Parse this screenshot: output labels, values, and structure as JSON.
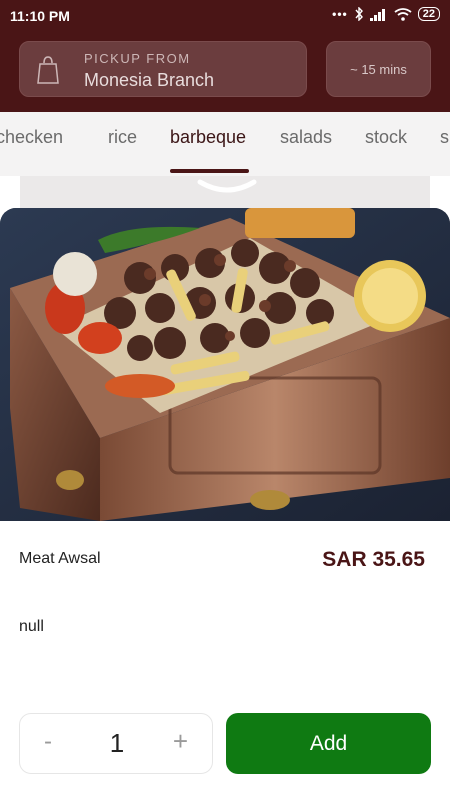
{
  "status_bar": {
    "time": "11:10 PM",
    "dots": "•••",
    "battery": "22"
  },
  "header": {
    "pickup_label": "PICKUP FROM",
    "branch_name": "Monesia Branch",
    "eta": "~ 15 mins"
  },
  "tabs": [
    {
      "label": "checken",
      "active": false
    },
    {
      "label": "rice",
      "active": false
    },
    {
      "label": "barbeque",
      "active": true
    },
    {
      "label": "salads",
      "active": false
    },
    {
      "label": "stock",
      "active": false
    },
    {
      "label": "s",
      "active": false
    }
  ],
  "item": {
    "name": "Meat Awsal",
    "price": "SAR 35.65",
    "description": "null"
  },
  "quantity": {
    "minus": "-",
    "value": "1",
    "plus": "+"
  },
  "add_button": "Add",
  "colors": {
    "brand": "#4a1516",
    "add_green": "#0f7a12"
  }
}
